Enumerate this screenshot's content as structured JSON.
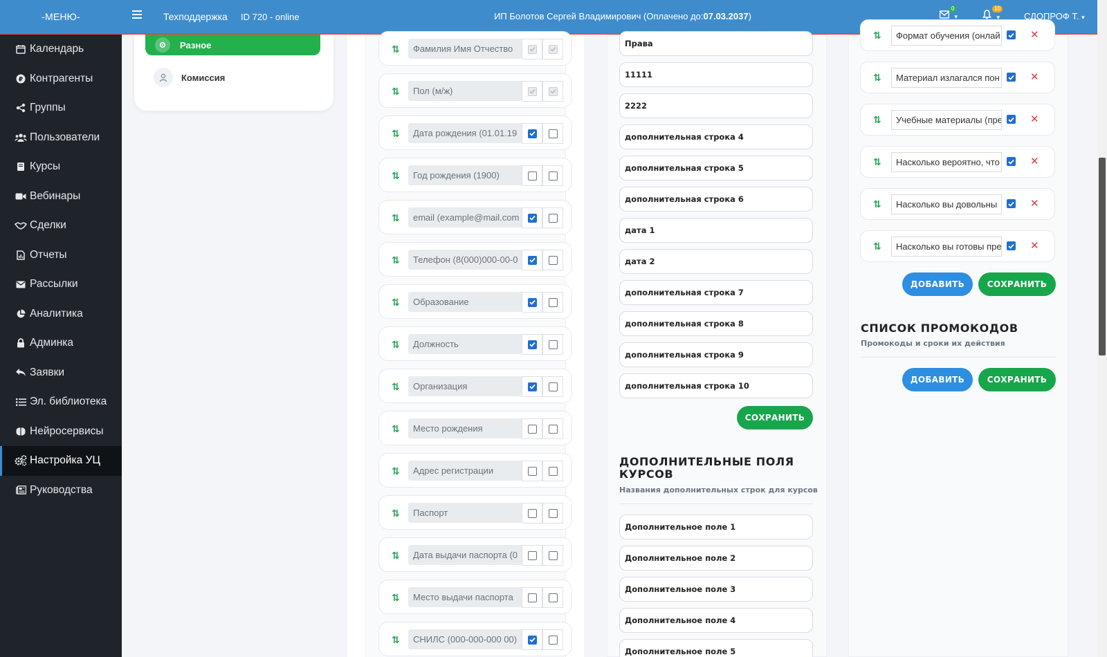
{
  "topbar": {
    "menu_label": "-МЕНЮ-",
    "support": "Техподдержка",
    "session": "ID 720 - online",
    "org_prefix": "ИП Болотов Сергей Владимирович (Оплачено до:",
    "org_date": "07.03.2037",
    "org_suffix": ")",
    "mail_count": "0",
    "bell_count": "10",
    "user": "СДОПРОФ Т."
  },
  "sidebar": {
    "items": [
      {
        "label": "Календарь",
        "icon": "calendar-icon"
      },
      {
        "label": "Контрагенты",
        "icon": "ruble-icon"
      },
      {
        "label": "Группы",
        "icon": "share-icon"
      },
      {
        "label": "Пользователи",
        "icon": "users-icon"
      },
      {
        "label": "Курсы",
        "icon": "book-icon"
      },
      {
        "label": "Вебинары",
        "icon": "video-icon"
      },
      {
        "label": "Сделки",
        "icon": "handshake-icon"
      },
      {
        "label": "Отчеты",
        "icon": "report-icon"
      },
      {
        "label": "Рассылки",
        "icon": "envelope-icon"
      },
      {
        "label": "Аналитика",
        "icon": "pie-chart-icon"
      },
      {
        "label": "Админка",
        "icon": "lock-icon"
      },
      {
        "label": "Заявки",
        "icon": "reply-icon"
      },
      {
        "label": "Эл. библиотека",
        "icon": "list-icon"
      },
      {
        "label": "Нейросервисы",
        "icon": "brain-icon"
      },
      {
        "label": "Настройка УЦ",
        "icon": "gears-icon",
        "active": true
      },
      {
        "label": "Руководства",
        "icon": "newspaper-icon"
      }
    ]
  },
  "left_menu": {
    "misc_label": "Разное",
    "commission_label": "Комиссия"
  },
  "fields": [
    {
      "label": "Фамилия Имя Отчество",
      "req": true,
      "uniq": true,
      "disabled": true
    },
    {
      "label": "Пол (м/ж)",
      "req": true,
      "uniq": true,
      "disabled": true
    },
    {
      "label": "Дата рождения (01.01.19",
      "req": true,
      "uniq": false
    },
    {
      "label": "Год рождения (1900)",
      "req": false,
      "uniq": false
    },
    {
      "label": "email (example@mail.com",
      "req": true,
      "uniq": false
    },
    {
      "label": "Телефон (8(000)000-00-0",
      "req": true,
      "uniq": false
    },
    {
      "label": "Образование",
      "req": true,
      "uniq": false
    },
    {
      "label": "Должность",
      "req": true,
      "uniq": false
    },
    {
      "label": "Организация",
      "req": true,
      "uniq": false
    },
    {
      "label": "Место рождения",
      "req": false,
      "uniq": false
    },
    {
      "label": "Адрес регистрации",
      "req": false,
      "uniq": false
    },
    {
      "label": "Паспорт",
      "req": false,
      "uniq": false
    },
    {
      "label": "Дата выдачи паспорта (0",
      "req": false,
      "uniq": false
    },
    {
      "label": "Место выдачи паспорта",
      "req": false,
      "uniq": false
    },
    {
      "label": "СНИЛС (000-000-000 00)",
      "req": true,
      "uniq": false
    }
  ],
  "extra_lines": [
    "Права",
    "11111",
    "2222",
    "дополнительная строка 4",
    "дополнительная строка 5",
    "дополнительная строка 6",
    "дата 1",
    "дата 2",
    "дополнительная строка 7",
    "дополнительная строка 8",
    "дополнительная строка 9",
    "дополнительная строка 10"
  ],
  "save_label": "СОХРАНИТЬ",
  "add_label": "ДОБАВИТЬ",
  "course_fields": {
    "title": "ДОПОЛНИТЕЛЬНЫЕ ПОЛЯ КУРСОВ",
    "subtitle": "Названия дополнительных строк для курсов",
    "items": [
      "Дополнительное поле 1",
      "Дополнительное поле 2",
      "Дополнительное поле 3",
      "Дополнительное поле 4",
      "Дополнительное поле 5"
    ]
  },
  "survey": [
    {
      "label": "Формат обучения (онлай",
      "checked": true
    },
    {
      "label": "Материал излагался пон",
      "checked": true
    },
    {
      "label": "Учебные материалы (пре",
      "checked": true
    },
    {
      "label": "Насколько вероятно, что",
      "checked": true
    },
    {
      "label": "Насколько вы довольны",
      "checked": true
    },
    {
      "label": "Насколько вы готовы пре",
      "checked": true
    }
  ],
  "promo": {
    "title": "СПИСОК ПРОМОКОДОВ",
    "subtitle": "Промокоды и сроки их действия"
  },
  "colors": {
    "topbar": "#3f8ccd",
    "sidebar": "#1f242b",
    "green": "#17a64b",
    "blue": "#2d8ee2",
    "danger": "#e0393e"
  }
}
